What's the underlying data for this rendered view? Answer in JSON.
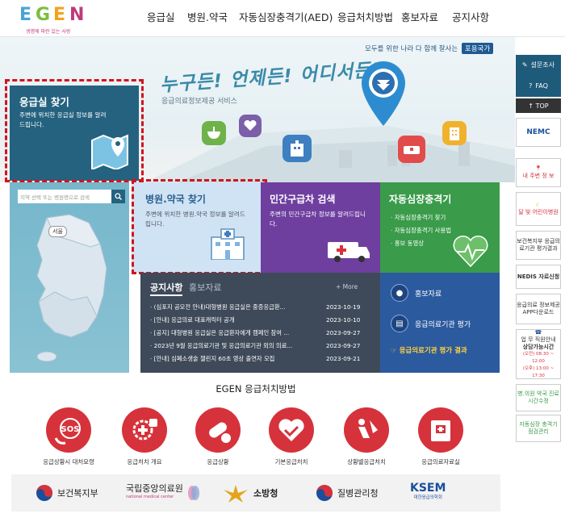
{
  "header": {
    "logo": {
      "letters": [
        "E",
        "G",
        "E",
        "N"
      ],
      "subtitle": "생명에 파란 있는 사랑"
    },
    "nav": [
      {
        "label": "응급실"
      },
      {
        "label": "병원.약국"
      },
      {
        "label": "자동심장충격기(AED)"
      },
      {
        "label": "응급처치방법"
      },
      {
        "label": "홍보자료"
      },
      {
        "label": "공지사항"
      }
    ]
  },
  "hero": {
    "slogan": "모두를 위한 나라 다 함께 잘사는",
    "slogan_badge": "포용국가",
    "headline": "누구든! 언제든! 어디서든!",
    "subline": "응급의료정보제공 서비스"
  },
  "er_card": {
    "title": "응급실 찾기",
    "desc": "주변에 위치한 응급실 정보를 알려드립니다."
  },
  "map": {
    "search_placeholder": "지역 선택 또는 병원명으로 검색",
    "seoul_label": "서울"
  },
  "hospital_card": {
    "title": "병원.약국 찾기",
    "desc": "주변에 위치한 병원.약국 정보를 알려드립니다."
  },
  "private_card": {
    "title": "민간구급차 검색",
    "desc": "주변의 민간구급차 정보를 알려드립니다."
  },
  "aed_card": {
    "title": "자동심장충격기",
    "items": [
      "자동심장충격기 찾기",
      "자동심장충격기 사용법",
      "홍보 동영상"
    ]
  },
  "notice": {
    "tab_active": "공지사항",
    "tab_other": "홍보자료",
    "more": "+ More",
    "items": [
      {
        "title": "(심포지 공모전 안내)대형병원 응급실은 중증응급환...",
        "date": "2023-10-19"
      },
      {
        "title": "[안내] 응급의료 대표캐릭터 공개",
        "date": "2023-10-10"
      },
      {
        "title": "[공지] 대형병원 응급실은 응급환자에게 캠페인 참여 ...",
        "date": "2023-09-27"
      },
      {
        "title": "2023년 9월 응급의료기관 및 응급의료기관 외의 의료...",
        "date": "2023-09-27"
      },
      {
        "title": "[안내] 심폐소생술 챌린지 60초 영상 출연자 모집",
        "date": "2023-09-21"
      }
    ]
  },
  "pr_panel": {
    "items": [
      "홍보자료",
      "응급의료기관 평가"
    ],
    "result": "응급의료기관 평가 결과"
  },
  "first_aid": {
    "title": "EGEN 응급처치방법",
    "items": [
      {
        "label": "응급상황시 대처요령",
        "icon": "sos-icon"
      },
      {
        "label": "응급처치 개요",
        "icon": "gear-cross-icon"
      },
      {
        "label": "응급상황",
        "icon": "pill-icon"
      },
      {
        "label": "기본응급처치",
        "icon": "heart-hands-icon"
      },
      {
        "label": "상황별응급처치",
        "icon": "injury-icon"
      },
      {
        "label": "응급의료자료실",
        "icon": "document-icon"
      }
    ]
  },
  "footer": {
    "logos": [
      "보건복지부",
      "국립중앙의료원",
      "소방청",
      "질병관리청",
      "KSEM"
    ],
    "nmc_sub": "national medical center",
    "ksem_sub": "대한응급의학회"
  },
  "quick": {
    "survey": "설문조사",
    "faq": "FAQ",
    "top": "↑ TOP",
    "nemc": "NEMC",
    "my_info": "내 주변 정 보",
    "night_hosp": "달 빛 어린이병원",
    "mohw_eval": "보건복지부 응급의료기관 평가결과",
    "nedis": "NEDIS 자료신청",
    "app": "응급의료 정보제공 APP다운로드",
    "hours_title": "업 무 직원안내",
    "hours_label": "상담가능시간",
    "hours_am": "(오전) 08:30 ~ 12:00",
    "hours_pm": "(오후) 13:00 ~ 17:30",
    "pharm": "병.의원 약국 진료시간수정",
    "aed_manage": "자동심장 충격기 점검관리"
  },
  "colors": {
    "teal": "#24627f",
    "purple": "#6f3fa0",
    "green": "#3a9b4a",
    "blue": "#2c5a9e",
    "red": "#d6323b",
    "light_blue": "#cfe3f5"
  }
}
